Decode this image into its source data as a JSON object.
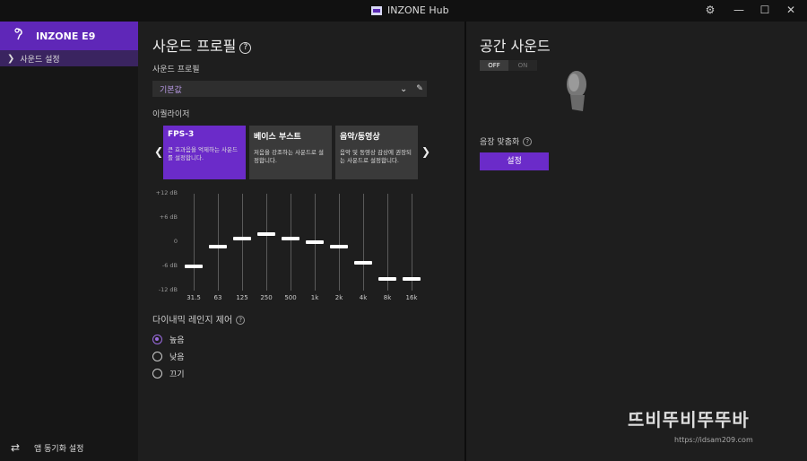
{
  "titlebar": {
    "app_title": "INZONE Hub",
    "settings_icon": "gear-icon",
    "minimize": "—",
    "maximize": "☐",
    "close": "✕"
  },
  "sidebar": {
    "device_name": "INZONE E9",
    "sub_item": "사운드 설정",
    "sync_label": "앱 동기화 설정"
  },
  "main": {
    "title": "사운드 프로필",
    "profile_label": "사운드 프로필",
    "profile_value": "기본값",
    "eq_label": "이퀄라이저",
    "presets": [
      {
        "name": "FPS-3",
        "desc": "큰 효과음을 억제하는 사운드를 설정합니다.",
        "active": true
      },
      {
        "name": "베이스 부스트",
        "desc": "저음을 강조하는 사운드로 설정합니다.",
        "active": false
      },
      {
        "name": "음악/동영상",
        "desc": "음악 및 동영상 감상에 권장되는 사운드로 설정합니다.",
        "active": false
      }
    ],
    "eq_ylabels": [
      "+12 dB",
      "+6 dB",
      "0",
      "-6 dB",
      "-12 dB"
    ],
    "eq_bands": [
      "31.5",
      "63",
      "125",
      "250",
      "500",
      "1k",
      "2k",
      "4k",
      "8k",
      "16k"
    ],
    "eq_values": [
      -6,
      -1,
      1,
      2,
      1,
      0,
      -1,
      -5,
      -9,
      -9
    ],
    "drc_label": "다이내믹 레인지 제어",
    "drc_options": [
      "높음",
      "낮음",
      "끄기"
    ],
    "drc_selected": 0
  },
  "right": {
    "title": "공간 사운드",
    "toggle_off": "OFF",
    "toggle_on": "ON",
    "fit_label": "음장 맞춤화",
    "set_button": "설정"
  },
  "watermark": {
    "text": "뜨비뚜비뚜뚜바",
    "url": "https://idsam209.com"
  },
  "colors": {
    "accent": "#6b2bc9",
    "bg": "#1e1e1e",
    "sidebar": "#161616"
  }
}
